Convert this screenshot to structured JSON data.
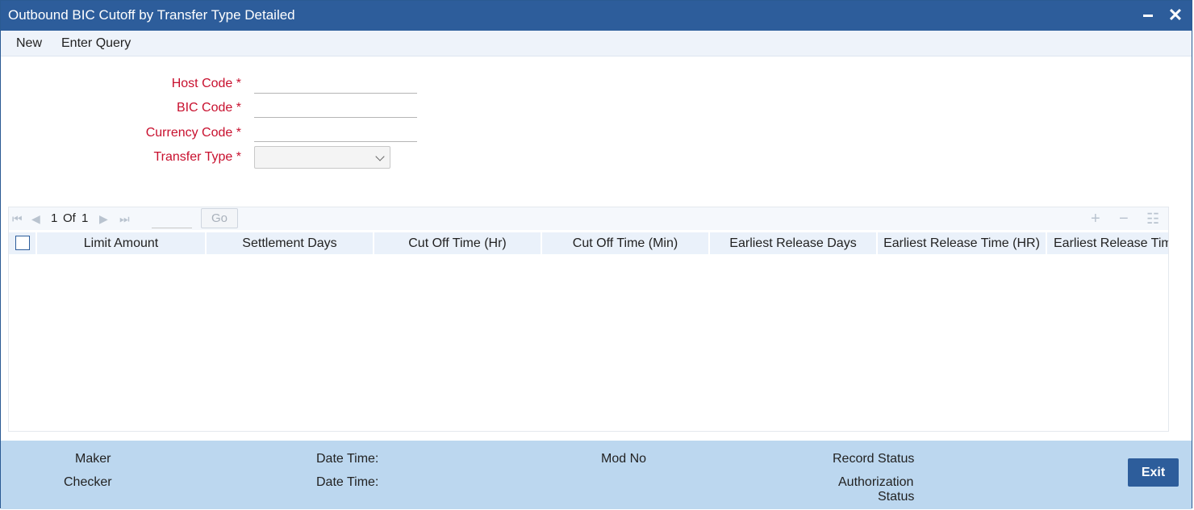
{
  "window": {
    "title": "Outbound BIC Cutoff by Transfer Type Detailed",
    "minimize_icon": "minimize-icon",
    "close_icon": "close-icon",
    "close_glyph": "✕"
  },
  "menu": {
    "new_label": "New",
    "enter_query_label": "Enter Query"
  },
  "form": {
    "host_code": {
      "label": "Host Code",
      "required": "*",
      "value": ""
    },
    "bic_code": {
      "label": "BIC Code",
      "required": "*",
      "value": ""
    },
    "currency_code": {
      "label": "Currency Code",
      "required": "*",
      "value": ""
    },
    "transfer_type": {
      "label": "Transfer Type",
      "required": "*",
      "value": ""
    }
  },
  "grid": {
    "pager": {
      "current_page": "1",
      "of_label": "Of",
      "total_pages": "1",
      "go_label": "Go",
      "first_glyph": "⏮",
      "prev_glyph": "◀",
      "next_glyph": "▶",
      "last_glyph": "⏭"
    },
    "tools": {
      "add_glyph": "+",
      "remove_glyph": "−",
      "list_glyph": "☷"
    },
    "columns": [
      "Limit Amount",
      "Settlement Days",
      "Cut Off Time (Hr)",
      "Cut Off Time (Min)",
      "Earliest Release Days",
      "Earliest Release Time (HR)",
      "Earliest Release Tim"
    ],
    "rows": []
  },
  "footer": {
    "maker_label": "Maker",
    "checker_label": "Checker",
    "maker_datetime_label": "Date Time:",
    "checker_datetime_label": "Date Time:",
    "mod_no_label": "Mod No",
    "record_status_label": "Record Status",
    "authorization_label_1": "Authorization",
    "authorization_label_2": "Status",
    "exit_label": "Exit"
  },
  "colors": {
    "title_bar": "#2d5d9b",
    "required_label": "#c8102e",
    "footer_bg": "#bcd7ef",
    "grid_header_bg": "#eaf1fa"
  }
}
